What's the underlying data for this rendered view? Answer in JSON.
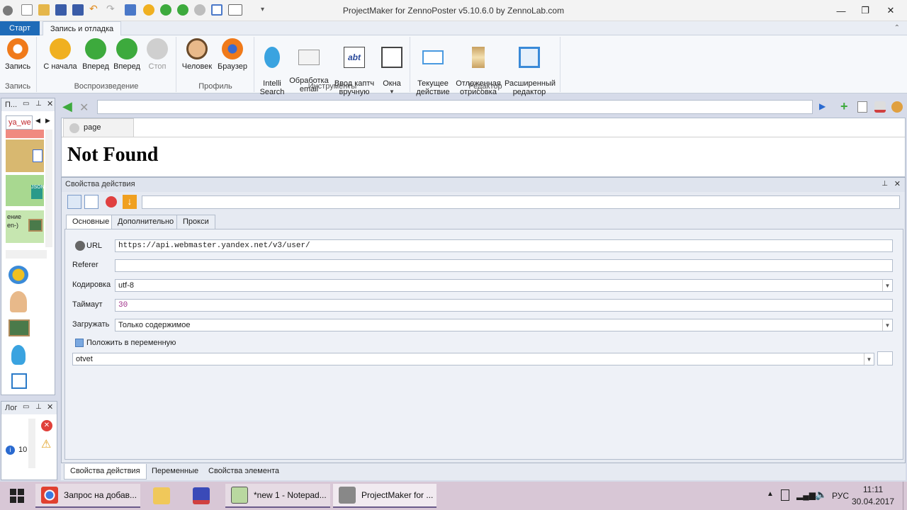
{
  "window": {
    "title": "ProjectMaker for ZennoPoster v5.10.6.0 by ZennoLab.com",
    "minimize": "—",
    "maximize": "❐",
    "close": "✕"
  },
  "ribbon_tabs": [
    "Старт",
    "Запись и отладка"
  ],
  "ribbon": {
    "record": {
      "label": "Запись",
      "group": "Запись"
    },
    "playback": {
      "group": "Воспроизведение",
      "items": [
        "С начала",
        "Вперед",
        "Вперед",
        "Стоп"
      ]
    },
    "profile": {
      "group": "Профиль",
      "items": [
        "Человек",
        "Браузер"
      ]
    },
    "tools": {
      "group": "Инструменты",
      "items": [
        "Intelli\nSearch",
        "Обработка\nemail",
        "Ввод каптч\nвручную",
        "Окна"
      ]
    },
    "editor": {
      "group": "Редактор",
      "items": [
        "Текущее\nдействие",
        "Отложенная\nотрисовка",
        "Расширенный\nредактор"
      ]
    }
  },
  "left_panel": {
    "header": "П...",
    "tab": "ya_we",
    "item_text_1": "ение",
    "item_text_2": "en-)",
    "log_header": "Лог",
    "log_count": "10"
  },
  "browser": {
    "address": "",
    "tab_label": "page",
    "content_heading": "Not Found"
  },
  "properties": {
    "header": "Свойства действия",
    "search_value": "",
    "tabs": [
      "Основные",
      "Дополнительно",
      "Прокси"
    ],
    "url_label": "URL",
    "url_value": "https://api.webmaster.yandex.net/v3/user/",
    "referer_label": "Referer",
    "referer_value": "",
    "encoding_label": "Кодировка",
    "encoding_value": "utf-8",
    "timeout_label": "Таймаут",
    "timeout_value": "30",
    "load_label": "Загружать",
    "load_value": "Только содержимое",
    "put_in_var_label": "Положить в переменную",
    "variable_value": "otvet"
  },
  "bottom_tabs": [
    "Свойства действия",
    "Переменные",
    "Свойства элемента"
  ],
  "taskbar": {
    "items": [
      "Запрос на добав...",
      "",
      "",
      "*new 1 - Notepad...",
      "ProjectMaker for ..."
    ],
    "lang": "РУС",
    "time": "11:11",
    "date": "30.04.2017"
  },
  "colors": {
    "accent": "#1e6bb8",
    "orange": "#f07a1a",
    "green": "#3daa3d",
    "taskbar": "#d8c7d6"
  }
}
